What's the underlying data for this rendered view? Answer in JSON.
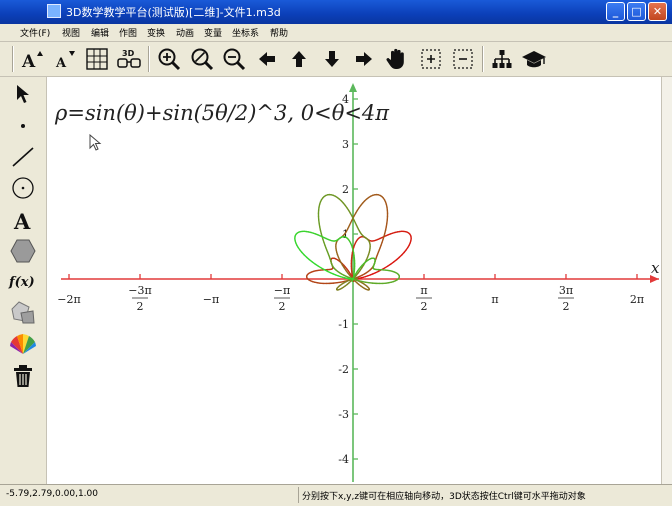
{
  "window": {
    "title": "3D数学教学平台(测试版)[二维]-文件1.m3d",
    "minimize_glyph": "_",
    "maximize_glyph": "□",
    "close_glyph": "✕"
  },
  "menu": [
    "文件(F)",
    "视图",
    "编辑",
    "作图",
    "变换",
    "动画",
    "变量",
    "坐标系",
    "帮助"
  ],
  "toolbar": [
    {
      "icon": "font-increase-icon",
      "label": "A"
    },
    {
      "icon": "font-decrease-icon",
      "label": "A"
    },
    {
      "icon": "grid-icon"
    },
    {
      "icon": "3d-glasses-icon",
      "label": "3D"
    },
    {
      "icon": "zoom-in-icon"
    },
    {
      "icon": "zoom-out-icon"
    },
    {
      "icon": "zoom-fit-icon"
    },
    {
      "icon": "pan-left-icon"
    },
    {
      "icon": "pan-up-icon"
    },
    {
      "icon": "pan-down-icon"
    },
    {
      "icon": "pan-right-icon"
    },
    {
      "icon": "hand-icon"
    },
    {
      "icon": "plus-box-icon"
    },
    {
      "icon": "minus-box-icon"
    },
    {
      "icon": "tree-icon"
    },
    {
      "icon": "graduation-cap-icon"
    }
  ],
  "palette": [
    {
      "icon": "select-arrow-icon"
    },
    {
      "icon": "point-icon"
    },
    {
      "icon": "line-icon"
    },
    {
      "icon": "circle-icon"
    },
    {
      "icon": "text-icon",
      "label": "A"
    },
    {
      "icon": "polygon-icon"
    },
    {
      "icon": "function-icon",
      "label": "f(x)"
    },
    {
      "icon": "fill-shape-icon"
    },
    {
      "icon": "color-wheel-icon"
    },
    {
      "icon": "trash-icon"
    }
  ],
  "canvas": {
    "formula": "ρ=sin(θ)+sin(5θ/2)^3, 0<θ<4π",
    "x_axis_label": "x",
    "x_ticks": [
      {
        "value": -6.283,
        "label": "−2π"
      },
      {
        "value": -4.712,
        "label_num": "−3π",
        "label_den": "2"
      },
      {
        "value": -3.1416,
        "label": "−π"
      },
      {
        "value": -1.5708,
        "label_num": "−π",
        "label_den": "2"
      },
      {
        "value": 1.5708,
        "label_num": "π",
        "label_den": "2"
      },
      {
        "value": 3.1416,
        "label": "π"
      },
      {
        "value": 4.712,
        "label_num": "3π",
        "label_den": "2"
      },
      {
        "value": 6.283,
        "label": "2π"
      }
    ],
    "y_ticks": [
      {
        "value": 4,
        "label": "4"
      },
      {
        "value": 3,
        "label": "3"
      },
      {
        "value": 2,
        "label": "2"
      },
      {
        "value": 1,
        "label": "1"
      },
      {
        "value": -1,
        "label": "-1"
      },
      {
        "value": -2,
        "label": "-2"
      },
      {
        "value": -3,
        "label": "-3"
      },
      {
        "value": -4,
        "label": "-4"
      }
    ],
    "colors": {
      "x_axis": "#e23a3a",
      "y_axis": "#5cb85c",
      "curve_start": "#e01010",
      "curve_end": "#30e030"
    }
  },
  "statusbar": {
    "coords": "-5.79,2.79,0.00,1.00",
    "hint": "分别按下x,y,z键可在相应轴向移动，3D状态按住Ctrl键可水平拖动对象"
  }
}
